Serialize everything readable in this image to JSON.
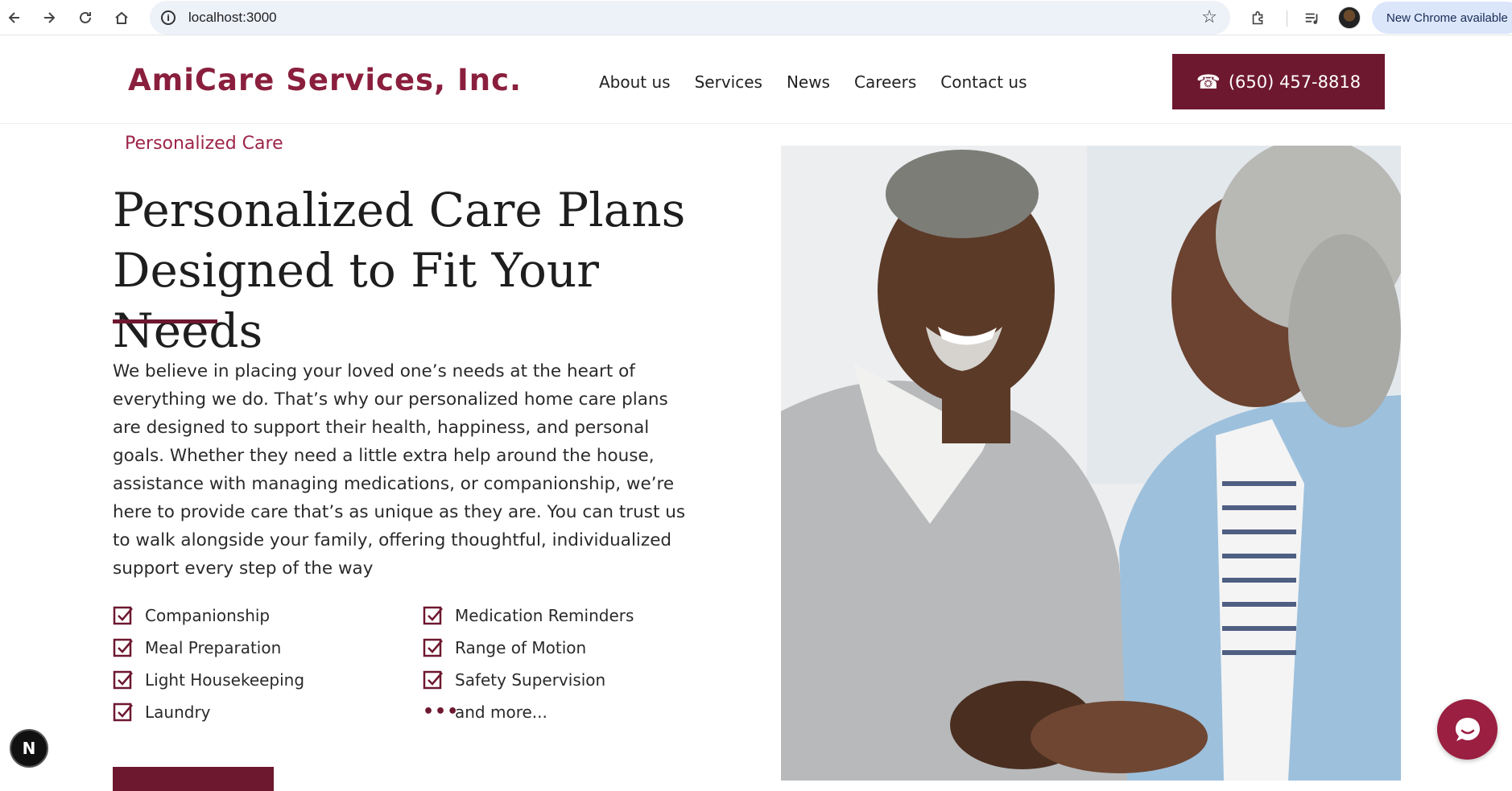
{
  "browser": {
    "url": "localhost:3000",
    "update_label": "New Chrome available"
  },
  "header": {
    "logo_text": "AmiCare Services, Inc.",
    "nav": [
      "About us",
      "Services",
      "News",
      "Careers",
      "Contact us"
    ],
    "phone_label": "(650) 457-8818"
  },
  "hero": {
    "eyebrow": "Personalized Care",
    "title": "Personalized Care Plans Designed to Fit Your Needs",
    "intro": "We believe in placing your loved one’s needs at the heart of everything we do. That’s why our personalized home care plans are designed to support their health, happiness, and personal goals. Whether they need a little extra help around the house, assistance with managing medications, or companionship, we’re here to provide care that’s as unique as they are. You can trust us to walk alongside your family, offering thoughtful, individualized support every step of the way",
    "features": [
      "Companionship",
      "Medication Reminders",
      "Meal Preparation",
      "Range of Motion",
      "Light Housekeeping",
      "Safety Supervision",
      "Laundry",
      "and more..."
    ]
  },
  "overlays": {
    "dev_badge": "N"
  },
  "colors": {
    "brand": "#6e1830",
    "brand_text": "#8a1f3d",
    "eyebrow": "#9c2448",
    "chat": "#9a1f40"
  },
  "icons": [
    "back-icon",
    "forward-icon",
    "reload-icon",
    "home-icon",
    "info-icon",
    "star-icon",
    "extensions-icon",
    "media-icon",
    "phone-icon",
    "checkbox-icon",
    "chat-icon"
  ]
}
